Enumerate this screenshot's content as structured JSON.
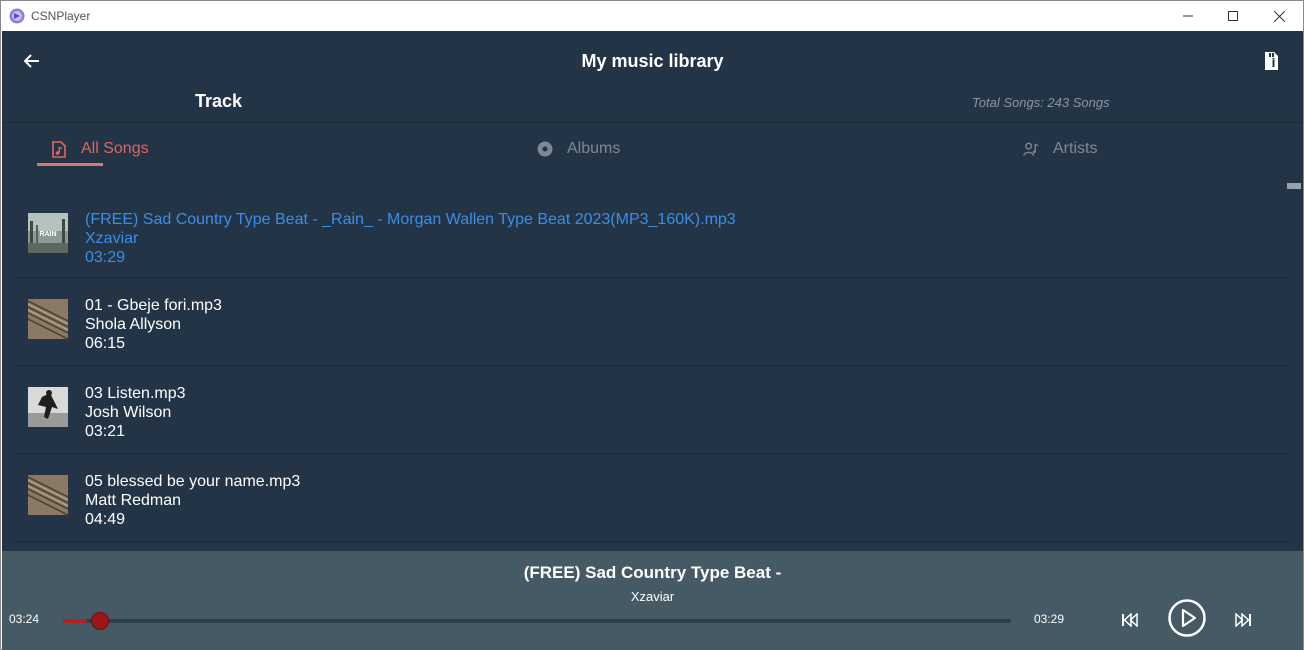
{
  "window": {
    "title": "CSNPlayer",
    "controls": [
      "minimize-icon",
      "maximize-icon",
      "close-icon"
    ]
  },
  "header": {
    "title": "My music library",
    "back_icon": "arrow-left-icon",
    "info_icon": "file-info-icon"
  },
  "section": {
    "title": "Track",
    "total_songs": "Total Songs: 243 Songs"
  },
  "tabs": [
    {
      "label": "All Songs",
      "icon": "music-file-icon",
      "active": true
    },
    {
      "label": "Albums",
      "icon": "disc-icon",
      "active": false
    },
    {
      "label": "Artists",
      "icon": "artist-icon",
      "active": false
    }
  ],
  "tracks": [
    {
      "title": "(FREE) Sad Country Type Beat - _Rain_ - Morgan Wallen Type Beat 2023(MP3_160K).mp3",
      "artist": "Xzaviar",
      "duration": "03:29",
      "active": true
    },
    {
      "title": "01 - Gbeje fori.mp3",
      "artist": "Shola Allyson",
      "duration": "06:15",
      "active": false
    },
    {
      "title": "03 Listen.mp3",
      "artist": "Josh Wilson",
      "duration": "03:21",
      "active": false
    },
    {
      "title": "05 blessed be your name.mp3",
      "artist": "Matt Redman",
      "duration": "04:49",
      "active": false
    }
  ],
  "player": {
    "title": "(FREE) Sad Country Type Beat -",
    "artist": "Xzaviar",
    "elapsed": "03:24",
    "total": "03:29",
    "progress": 0.025,
    "controls": [
      "skip-previous-icon",
      "play-icon",
      "skip-next-icon"
    ]
  },
  "colors": {
    "background": "#243447",
    "player": "#455a64",
    "accent": "#e0675f",
    "active_track": "#3a8ee6",
    "progress": "#b22222"
  }
}
